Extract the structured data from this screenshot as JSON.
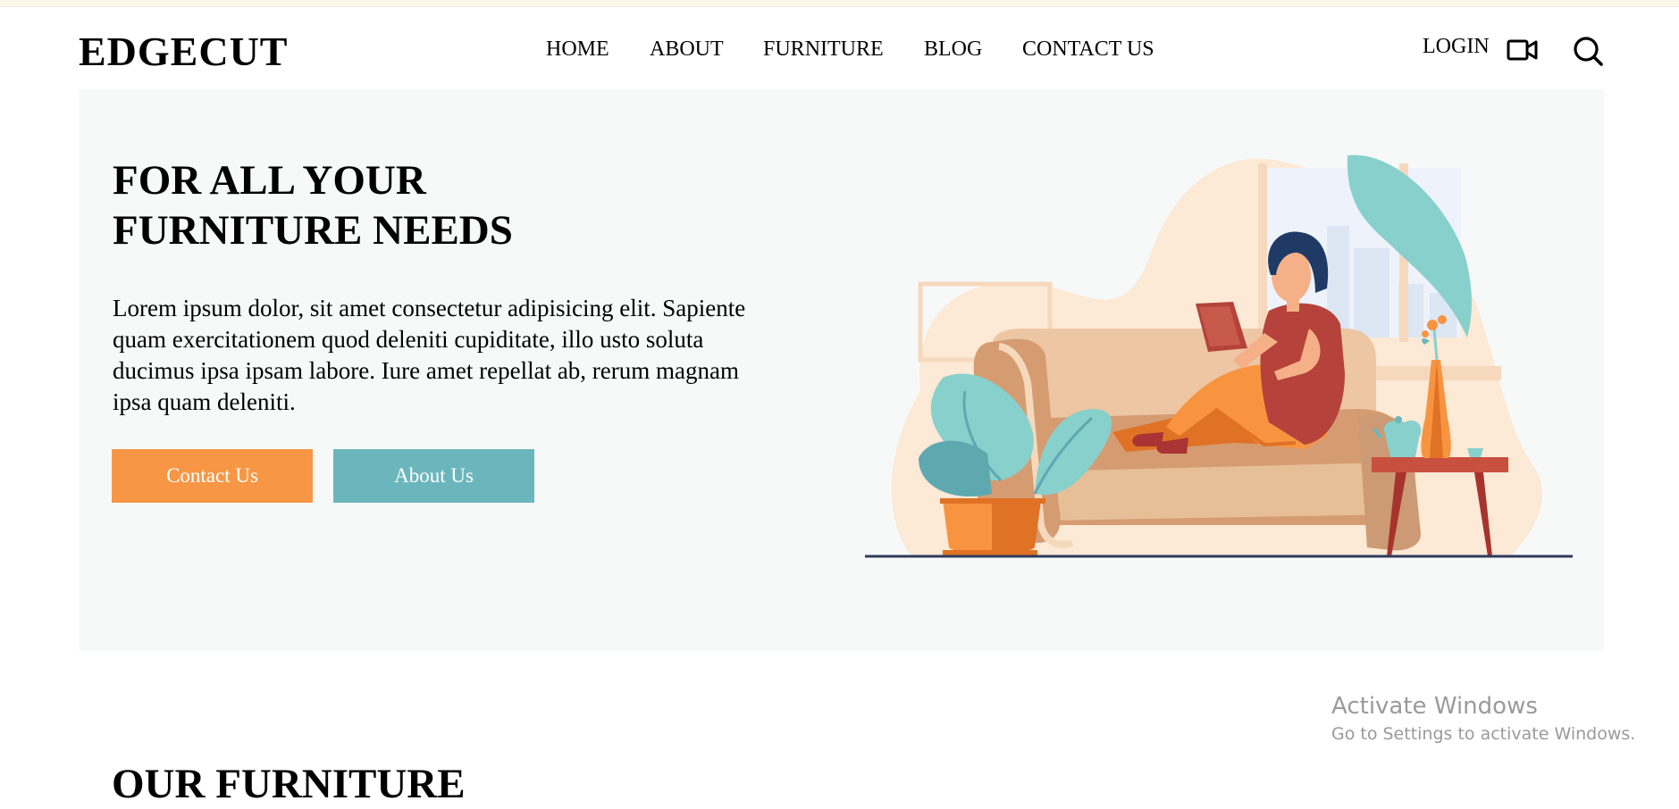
{
  "header": {
    "logo": "EDGECUT",
    "nav": [
      {
        "label": "HOME"
      },
      {
        "label": "ABOUT"
      },
      {
        "label": "FURNITURE"
      },
      {
        "label": "BLOG"
      },
      {
        "label": "CONTACT US"
      }
    ],
    "login_label": "LOGIN",
    "icons": [
      "video-camera-icon",
      "search-icon"
    ]
  },
  "hero": {
    "title_line1": "FOR ALL YOUR",
    "title_line2": "FURNITURE NEEDS",
    "description": "Lorem ipsum dolor, sit amet consectetur adipisicing elit. Sapiente quam exercitationem quod deleniti cupiditate, illo usto soluta ducimus ipsa ipsam labore. Iure amet repellat ab, rerum magnam ipsa quam deleniti.",
    "contact_button": "Contact Us",
    "about_button": "About Us"
  },
  "section": {
    "title": "OUR FURNITURE"
  },
  "watermark": {
    "title": "Activate Windows",
    "subtitle": "Go to Settings to activate Windows."
  },
  "colors": {
    "accent_orange": "#f79746",
    "accent_teal": "#6bb6bd",
    "hero_bg": "#f7f9f8"
  }
}
